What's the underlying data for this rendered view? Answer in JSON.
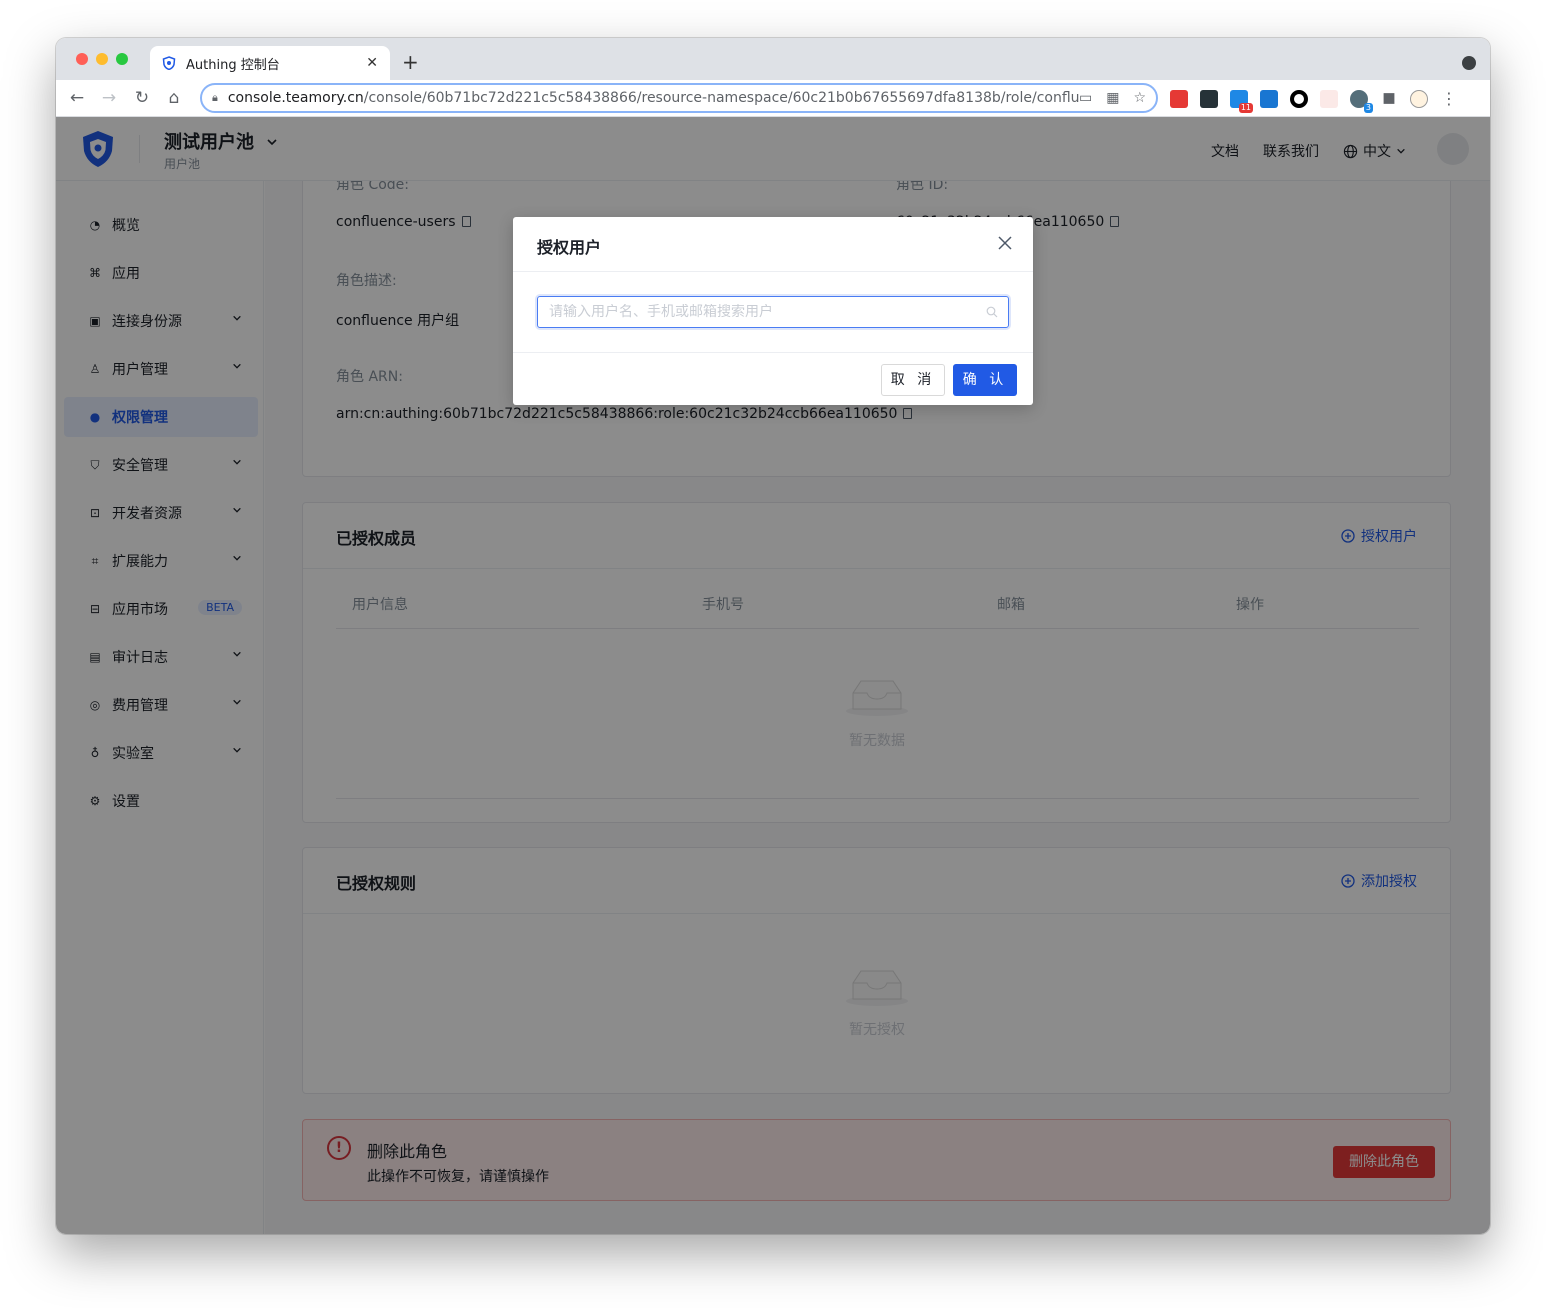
{
  "browser": {
    "tab_title": "Authing 控制台",
    "url_host": "console.teamory.cn",
    "url_path": "/console/60b71bc72d221c5c58438866/resource-namespace/60c21b0b67655697dfa8138b/role/conflu...",
    "ext_badge_1": "11",
    "ext_badge_2": "3"
  },
  "header": {
    "pool_name": "测试用户池",
    "pool_sub": "用户池",
    "docs": "文档",
    "contact": "联系我们",
    "language": "中文"
  },
  "sidebar": {
    "items": [
      {
        "label": "概览",
        "icon": "dashboard-icon"
      },
      {
        "label": "应用",
        "icon": "apps-icon"
      },
      {
        "label": "连接身份源",
        "icon": "identity-icon"
      },
      {
        "label": "用户管理",
        "icon": "user-icon"
      },
      {
        "label": "权限管理",
        "icon": "lock-icon"
      },
      {
        "label": "安全管理",
        "icon": "shield-icon"
      },
      {
        "label": "开发者资源",
        "icon": "code-icon"
      },
      {
        "label": "扩展能力",
        "icon": "extension-icon"
      },
      {
        "label": "应用市场",
        "icon": "market-icon"
      },
      {
        "label": "审计日志",
        "icon": "log-icon"
      },
      {
        "label": "费用管理",
        "icon": "billing-icon"
      },
      {
        "label": "实验室",
        "icon": "bulb-icon"
      },
      {
        "label": "设置",
        "icon": "gear-icon"
      }
    ],
    "beta_label": "BETA"
  },
  "role_info": {
    "code_label": "角色 Code:",
    "code_value": "confluence-users",
    "id_label": "角色 ID:",
    "id_value": "60c21c32b24ccb66ea110650",
    "desc_label": "角色描述:",
    "desc_value": "confluence 用户组",
    "arn_label": "角色 ARN:",
    "arn_value": "arn:cn:authing:60b71bc72d221c5c58438866:role:60c21c32b24ccb66ea110650"
  },
  "members": {
    "title": "已授权成员",
    "action": "授权用户",
    "columns": [
      "用户信息",
      "手机号",
      "邮箱",
      "操作"
    ],
    "empty": "暂无数据"
  },
  "rules": {
    "title": "已授权规则",
    "action": "添加授权",
    "empty": "暂无授权"
  },
  "danger": {
    "title": "删除此角色",
    "desc": "此操作不可恢复，请谨慎操作",
    "button": "删除此角色"
  },
  "modal": {
    "title": "授权用户",
    "search_placeholder": "请输入用户名、手机或邮箱搜索用户",
    "cancel": "取 消",
    "ok": "确 认"
  },
  "colors": {
    "primary": "#215ae5",
    "danger": "#e33a3a"
  }
}
